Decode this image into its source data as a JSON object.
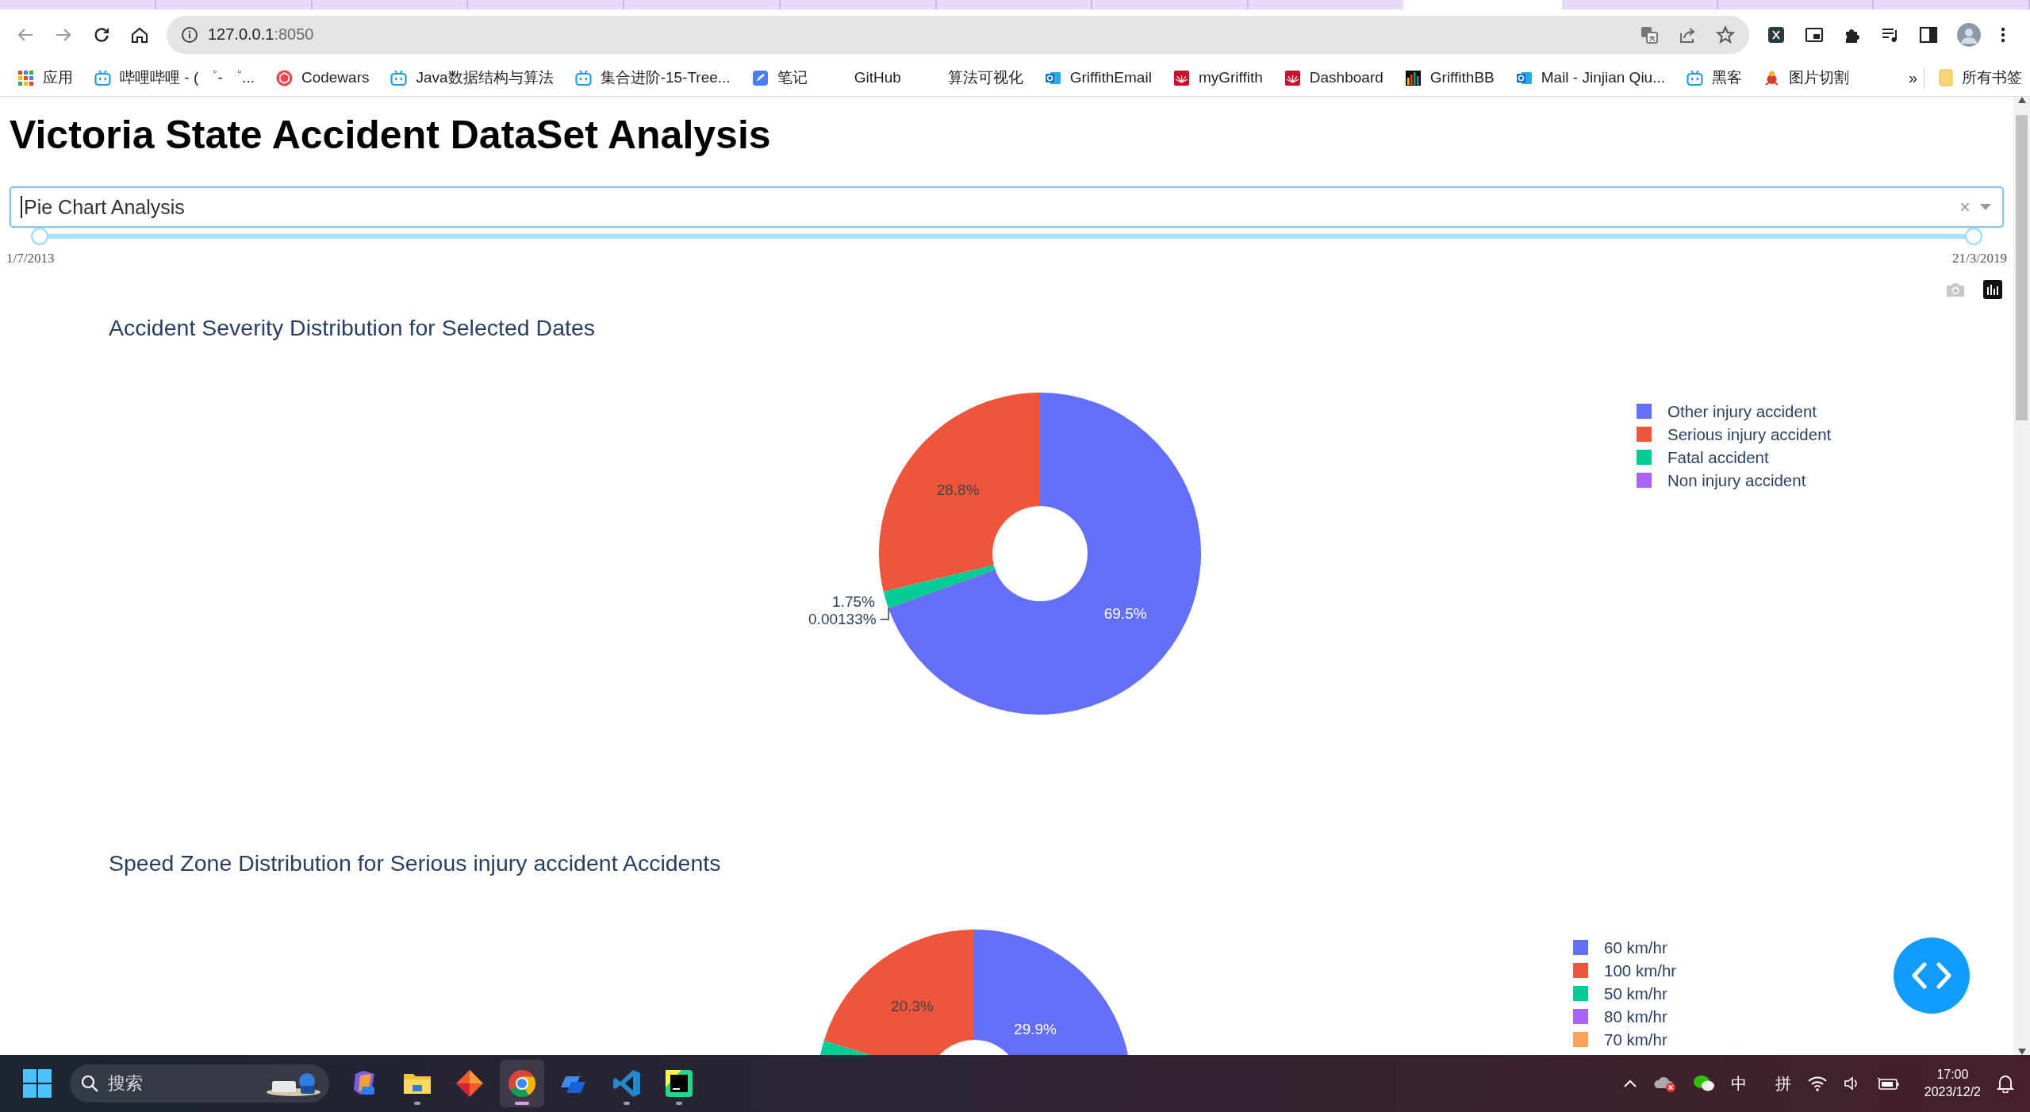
{
  "browser": {
    "address_bar": {
      "host": "127.0.0.1",
      "rest": ":8050"
    },
    "bookmarks": [
      {
        "label": "应用",
        "kind": "apps"
      },
      {
        "label": "哔哩哔哩 - ( ゜- ゜...",
        "kind": "bilibili"
      },
      {
        "label": "Codewars",
        "kind": "codewars"
      },
      {
        "label": "Java数据结构与算法",
        "kind": "bilibili"
      },
      {
        "label": "集合进阶-15-Tree...",
        "kind": "bilibili"
      },
      {
        "label": "笔记",
        "kind": "note"
      },
      {
        "label": "GitHub",
        "kind": "none"
      },
      {
        "label": "算法可视化",
        "kind": "none"
      },
      {
        "label": "GriffithEmail",
        "kind": "outlook"
      },
      {
        "label": "myGriffith",
        "kind": "griffith"
      },
      {
        "label": "Dashboard",
        "kind": "griffith"
      },
      {
        "label": "GriffithBB",
        "kind": "bars"
      },
      {
        "label": "Mail - Jinjian Qiu...",
        "kind": "outlook"
      },
      {
        "label": "黑客",
        "kind": "bilibili"
      },
      {
        "label": "图片切割",
        "kind": "fruit"
      }
    ],
    "more_bookmarks": "»",
    "all_bookmarks": "所有书签"
  },
  "page": {
    "title": "Victoria State Accident DataSet Analysis",
    "dropdown": {
      "value": "Pie Chart Analysis",
      "clear": "×"
    },
    "date_range": {
      "level": 1,
      "start": "1/7/2013",
      "end": "21/3/2019"
    },
    "charts": [
      {
        "chart_data": {
          "type": "donut",
          "title": "Accident Severity Distribution for Selected Dates",
          "categories": [
            "Other injury accident",
            "Serious injury accident",
            "Fatal accident",
            "Non injury accident"
          ],
          "values": [
            69.5,
            28.8,
            1.75,
            0.00133
          ],
          "value_labels": [
            "69.5%",
            "28.8%",
            "1.75%",
            "0.00133%"
          ]
        },
        "legend": [
          {
            "color": "#636efa"
          },
          {
            "color": "#ef553b"
          },
          {
            "color": "#00cc96"
          },
          {
            "color": "#ab63fa"
          }
        ]
      },
      {
        "kind": "picture",
        "title": "Speed Zone Distribution for Serious injury accident Accidents",
        "slice_labels": [
          "29.9%",
          "20.3%"
        ],
        "legend": [
          {
            "label": "60 km/hr",
            "color": "#636efa"
          },
          {
            "label": "100 km/hr",
            "color": "#ef553b"
          },
          {
            "label": "50 km/hr",
            "color": "#00cc96"
          },
          {
            "label": "80 km/hr",
            "color": "#ab63fa"
          },
          {
            "label": "70 km/hr",
            "color": "#ffa15a"
          }
        ]
      }
    ]
  },
  "taskbar": {
    "search": {
      "placeholder": "搜索"
    },
    "apps": [
      {
        "kind": "copilot",
        "running": false,
        "selected": false
      },
      {
        "kind": "files",
        "running": true,
        "selected": false
      },
      {
        "kind": "diamond",
        "running": false,
        "selected": false
      },
      {
        "kind": "chrome",
        "running": true,
        "selected": true
      },
      {
        "kind": "blue",
        "running": false,
        "selected": false
      },
      {
        "kind": "vscode",
        "running": true,
        "selected": false
      },
      {
        "kind": "pycharm",
        "running": true,
        "selected": false
      }
    ],
    "tray": {
      "ime_mode": "中",
      "ime": "拼",
      "time": "17:00",
      "date": "2023/12/2"
    }
  }
}
